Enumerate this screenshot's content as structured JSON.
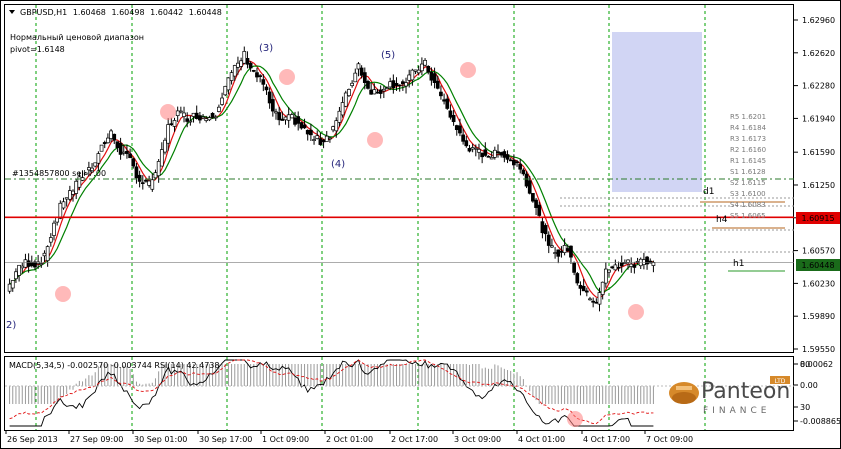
{
  "chart_data": [
    {
      "type": "candlestick",
      "title": "GBPUSD,H1",
      "ohlc_header": [
        "1.60468",
        "1.60498",
        "1.60442",
        "1.60448"
      ],
      "annotation_lines": [
        "Нормальный ценовой диапазон",
        "pivot=1.6148"
      ],
      "order_label": "#1354857800 sell 7.00",
      "wave_labels": [
        "(3)",
        "(5)",
        "(4)",
        "2)"
      ],
      "y_axis_ticks": [
        "1.62960",
        "1.62620",
        "1.62280",
        "1.61940",
        "1.61590",
        "1.61250",
        "1.60910",
        "1.60570",
        "1.60230",
        "1.59890",
        "1.59550"
      ],
      "ylim": [
        1.5955,
        1.6296
      ],
      "current_price": "1.60448",
      "order_price": "1.60915",
      "x_axis_labels": [
        "26 Sep 2013",
        "27 Sep 09:00",
        "30 Sep 01:00",
        "30 Sep 17:00",
        "1 Oct 09:00",
        "2 Oct 01:00",
        "2 Oct 17:00",
        "3 Oct 09:00",
        "4 Oct 01:00",
        "4 Oct 17:00",
        "7 Oct 09:00"
      ],
      "level_labels": [
        "d1",
        "h4",
        "h1"
      ],
      "pivot_levels": [
        "R5 1.6201",
        "R4 1.6184",
        "R3 1.6173",
        "R2 1.6160",
        "R1 1.6145",
        "S1 1.6128",
        "S2 1.6115",
        "S3 1.6100",
        "S4 1.6083",
        "S5 1.6065"
      ],
      "close_path": [
        1.6015,
        1.6035,
        1.6045,
        1.6043,
        1.605,
        1.6085,
        1.611,
        1.612,
        1.6135,
        1.6145,
        1.6165,
        1.6178,
        1.616,
        1.615,
        1.613,
        1.6125,
        1.6145,
        1.6185,
        1.62,
        1.6195,
        1.6197,
        1.6195,
        1.62,
        1.6228,
        1.6245,
        1.626,
        1.6242,
        1.623,
        1.62,
        1.619,
        1.6195,
        1.6185,
        1.6175,
        1.617,
        1.6178,
        1.62,
        1.6225,
        1.625,
        1.6225,
        1.622,
        1.623,
        1.623,
        1.623,
        1.6245,
        1.625,
        1.623,
        1.621,
        1.619,
        1.617,
        1.616,
        1.6158,
        1.6155,
        1.616,
        1.615,
        1.6145,
        1.612,
        1.609,
        1.606,
        1.6055,
        1.606,
        1.6025,
        1.601,
        1.6005,
        1.6035,
        1.604,
        1.6045,
        1.6042,
        1.6048,
        1.6045
      ],
      "series": [
        {
          "name": "MA fast",
          "color": "#e01010"
        },
        {
          "name": "MA slow",
          "color": "#008000"
        }
      ]
    },
    {
      "type": "histogram",
      "title": "MACD(5,34,5) -0.002570 -0.003744 RSI(14) 42.4738",
      "y_axis_ticks": [
        "0.00062",
        "0.00",
        "30",
        "-0.008865"
      ],
      "rsi_right_tick": "80"
    }
  ],
  "branding": {
    "name": "Panteon",
    "sub": "FINANCE",
    "badge": "LTD",
    "colors": {
      "accent": "#d6892a",
      "text": "#4a4a4a"
    }
  },
  "colors": {
    "up_fill": "#ffffff",
    "down_fill": "#000000",
    "order_line": "#e00000",
    "vgrid": "#00a000",
    "projection": "#c8cdf2"
  }
}
